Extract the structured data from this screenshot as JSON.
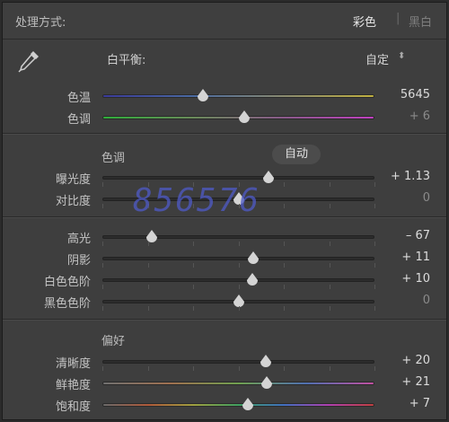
{
  "header": {
    "title": "处理方式:",
    "mode_color": "彩色",
    "mode_bw": "黑白"
  },
  "white_balance": {
    "label": "白平衡:",
    "value": "自定",
    "icon": "eyedropper-icon",
    "sliders": [
      {
        "label": "色温",
        "value": "5645",
        "dim": false,
        "position": 0.37
      },
      {
        "label": "色调",
        "value": "+ 6",
        "dim": true,
        "position": 0.52
      }
    ]
  },
  "tone": {
    "section_label": "色调",
    "auto_label": "自动",
    "sliders": [
      {
        "label": "曝光度",
        "value": "+ 1.13",
        "dim": false,
        "position": 0.61
      },
      {
        "label": "对比度",
        "value": "0",
        "dim": true,
        "position": 0.5
      },
      {
        "label": "高光",
        "value": "– 67",
        "dim": false,
        "position": 0.18
      },
      {
        "label": "阴影",
        "value": "+ 11",
        "dim": false,
        "position": 0.555
      },
      {
        "label": "白色色阶",
        "value": "+ 10",
        "dim": false,
        "position": 0.55
      },
      {
        "label": "黑色色阶",
        "value": "0",
        "dim": true,
        "position": 0.5
      }
    ]
  },
  "presence": {
    "section_label": "偏好",
    "sliders": [
      {
        "label": "清晰度",
        "value": "+ 20",
        "dim": false,
        "position": 0.6
      },
      {
        "label": "鲜艳度",
        "value": "+ 21",
        "dim": false,
        "position": 0.605
      },
      {
        "label": "饱和度",
        "value": "+ 7",
        "dim": false,
        "position": 0.535
      }
    ]
  },
  "watermark": "856576",
  "colors": {
    "panel_bg": "#3e3e3e",
    "text": "#c8c8c8",
    "thumb": "#d4d4d4",
    "watermark": "#4e5ac8"
  }
}
